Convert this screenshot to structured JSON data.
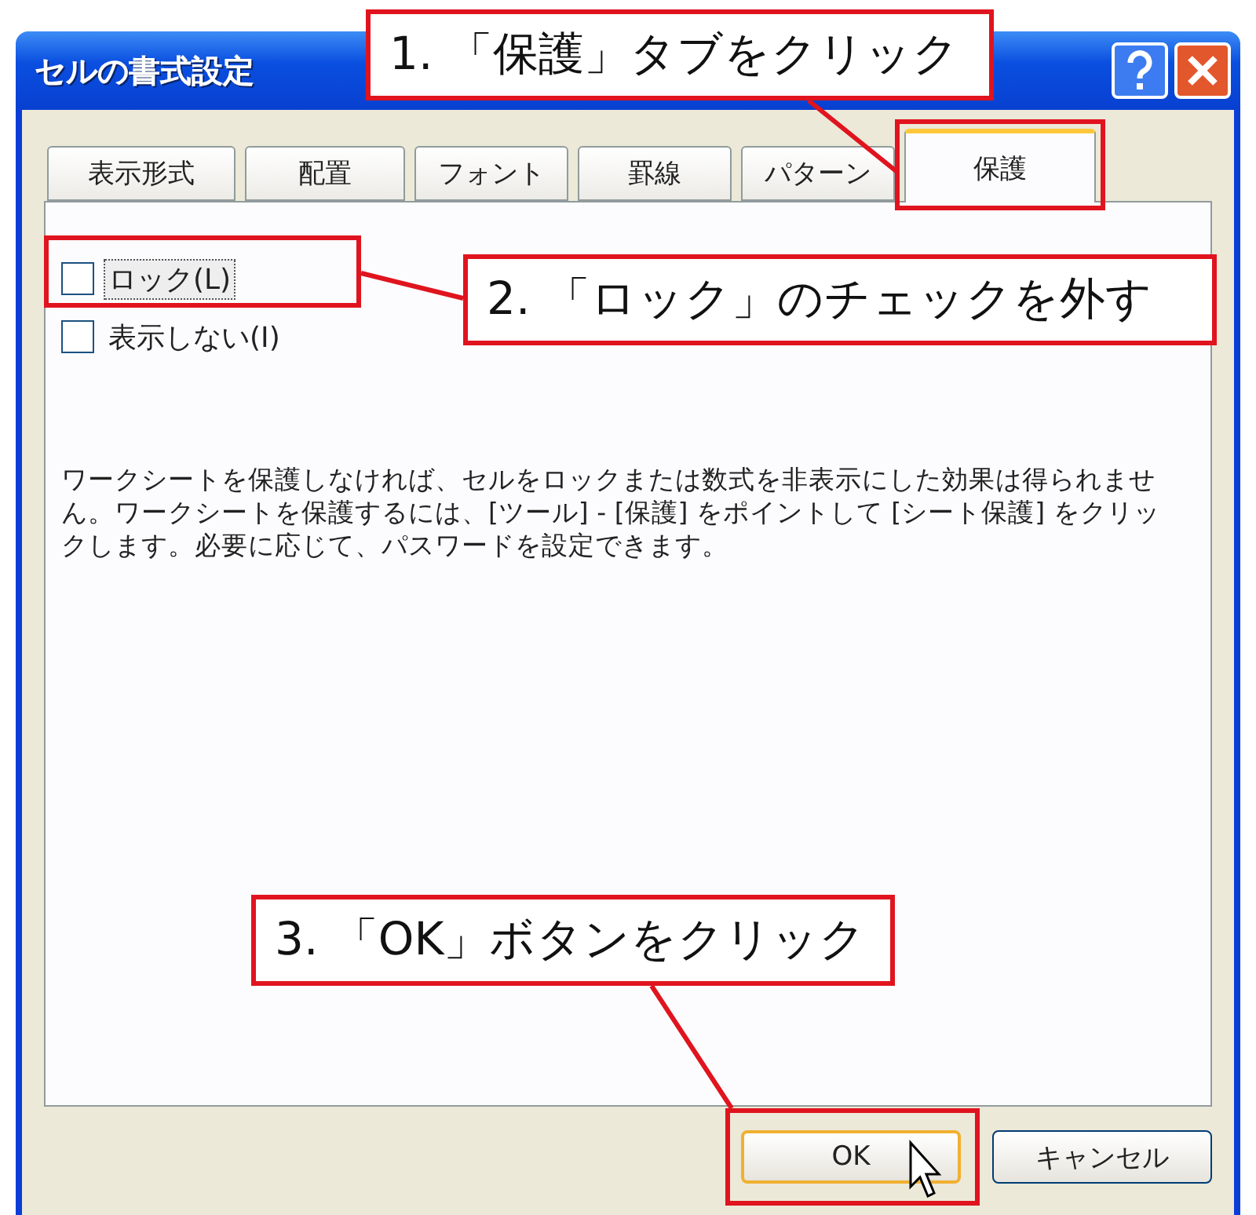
{
  "window": {
    "title": "セルの書式設定"
  },
  "tabs": [
    {
      "label": "表示形式",
      "selected": false
    },
    {
      "label": "配置",
      "selected": false
    },
    {
      "label": "フォント",
      "selected": false
    },
    {
      "label": "罫線",
      "selected": false
    },
    {
      "label": "パターン",
      "selected": false
    },
    {
      "label": "保護",
      "selected": true
    }
  ],
  "checkboxes": [
    {
      "label": "ロック(L)",
      "checked": false,
      "focused": true
    },
    {
      "label": "表示しない(I)",
      "checked": false,
      "focused": false
    }
  ],
  "description": "ワークシートを保護しなければ、セルをロックまたは数式を非表示にした効果は得られません。ワークシートを保護するには、[ツール] - [保護] をポイントして [シート保護] をクリックします。必要に応じて、パスワードを設定できます。",
  "buttons": [
    {
      "label": "OK",
      "kind": "default"
    },
    {
      "label": "キャンセル",
      "kind": "normal"
    }
  ],
  "annotations": [
    {
      "text": "1. 「保護」タブをクリック"
    },
    {
      "text": "2. 「ロック」のチェックを外す"
    },
    {
      "text": "3. 「OK」ボタンをクリック"
    }
  ]
}
